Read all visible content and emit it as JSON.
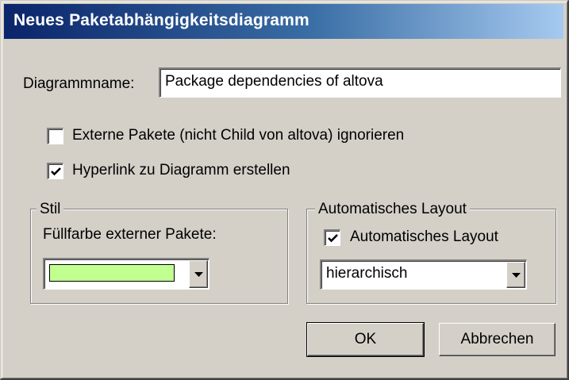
{
  "dialog": {
    "title": "Neues Paketabhängigkeitsdiagramm"
  },
  "name_field": {
    "label": "Diagrammname:",
    "value": "Package dependencies of altova"
  },
  "options": {
    "ignore_external": {
      "label": "Externe Pakete (nicht Child von altova) ignorieren",
      "checked": false
    },
    "create_hyperlink": {
      "label": "Hyperlink zu Diagramm erstellen",
      "checked": true
    }
  },
  "style_group": {
    "title": "Stil",
    "fill_label": "Füllfarbe externer Pakete:",
    "fill_color": "#c0ff90"
  },
  "layout_group": {
    "title": "Automatisches Layout",
    "checkbox_label": "Automatisches Layout",
    "checked": true,
    "selected_layout": "hierarchisch"
  },
  "buttons": {
    "ok": "OK",
    "cancel": "Abbrechen"
  },
  "colors": {
    "dialog_face": "#d4d0c8",
    "title_start": "#0a246a",
    "title_end": "#a6caf0"
  }
}
